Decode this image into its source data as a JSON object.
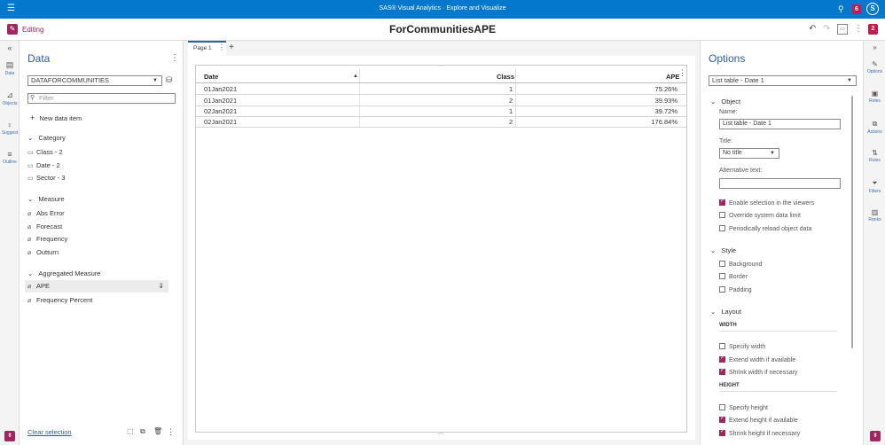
{
  "topbar": {
    "title": "SAS® Visual Analytics · Explore and Visualize",
    "notifications": "6",
    "avatar_initial": "S"
  },
  "editbar": {
    "mode_label": "Editing",
    "report_title": "ForCommunitiesAPE",
    "badge": "2"
  },
  "left_rail": [
    {
      "label": "Data",
      "icon": "cylinder"
    },
    {
      "label": "Objects",
      "icon": "chart"
    },
    {
      "label": "Suggest",
      "icon": "lightbulb"
    },
    {
      "label": "Outline",
      "icon": "list"
    }
  ],
  "data_pane": {
    "title": "Data",
    "source": "DATAFORCOMMUNITIES",
    "filter_placeholder": "Filter",
    "new_item": "New data item",
    "groups": [
      {
        "label": "Category",
        "items": [
          "Class - 2",
          "Date - 2",
          "Sector - 3"
        ]
      },
      {
        "label": "Measure",
        "items": [
          "Abs Error",
          "Forecast",
          "Frequency",
          "Outturn"
        ]
      },
      {
        "label": "Aggregated Measure",
        "items": [
          "APE",
          "Frequency Percent"
        ]
      }
    ],
    "clear_selection": "Clear selection"
  },
  "page": {
    "tab_label": "Page 1",
    "add": "+"
  },
  "table": {
    "columns": [
      "Date",
      "Class",
      "APE"
    ],
    "rows": [
      [
        "01Jan2021",
        "1",
        "75.26%"
      ],
      [
        "01Jan2021",
        "2",
        "39.93%"
      ],
      [
        "02Jan2021",
        "1",
        "39.72%"
      ],
      [
        "02Jan2021",
        "2",
        "176.84%"
      ]
    ]
  },
  "options": {
    "title": "Options",
    "object_select": "List table - Date 1",
    "sections": {
      "object": "Object",
      "style": "Style",
      "layout": "Layout"
    },
    "name_label": "Name:",
    "name_value": "List table - Date 1",
    "title_label": "Title:",
    "title_value": "No title",
    "alt_label": "Alternative text:",
    "alt_value": "",
    "object_checks": [
      {
        "label": "Enable selection in the viewers",
        "checked": true
      },
      {
        "label": "Override system data limit",
        "checked": false
      },
      {
        "label": "Periodically reload object data",
        "checked": false
      }
    ],
    "style_checks": [
      {
        "label": "Background",
        "checked": false
      },
      {
        "label": "Border",
        "checked": false
      },
      {
        "label": "Padding",
        "checked": false
      }
    ],
    "width_head": "WIDTH",
    "width_checks": [
      {
        "label": "Specify width",
        "checked": false
      },
      {
        "label": "Extend width if available",
        "checked": true
      },
      {
        "label": "Shrink width if necessary",
        "checked": true
      }
    ],
    "height_head": "HEIGHT",
    "height_checks": [
      {
        "label": "Specify height",
        "checked": false
      },
      {
        "label": "Extend height if available",
        "checked": true
      },
      {
        "label": "Shrink height if necessary",
        "checked": true
      }
    ]
  },
  "right_rail": [
    {
      "label": "Options",
      "icon": "options"
    },
    {
      "label": "Roles",
      "icon": "roles"
    },
    {
      "label": "Actions",
      "icon": "actions"
    },
    {
      "label": "Rules",
      "icon": "rules"
    },
    {
      "label": "Filters",
      "icon": "filter"
    },
    {
      "label": "Ranks",
      "icon": "ranks"
    }
  ],
  "colors": {
    "brand_blue": "#0378cd",
    "accent": "#a12660",
    "link": "#2b5ea7"
  }
}
